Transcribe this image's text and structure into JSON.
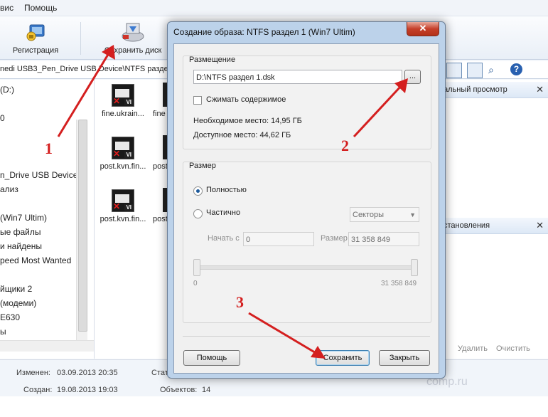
{
  "menu": {
    "items": [
      "вис",
      "Помощь"
    ]
  },
  "toolbar": {
    "register_label": "Регистрация",
    "save_disk_label": "Сохранить диск"
  },
  "address": {
    "path": "nedi USB3_Pen_Drive USB Device\\NTFS раздел 1"
  },
  "tree": {
    "items": [
      "(D:)",
      "0",
      "",
      "",
      "",
      "n_Drive USB Device",
      "ализ",
      "",
      " (Win7 Ultim)",
      "ые файлы",
      "и найдены",
      "peed Most Wanted",
      "",
      "йщики 2",
      "(модеми)",
      "E630",
      "ы"
    ]
  },
  "files": [
    {
      "name": "fine.ukrain..."
    },
    {
      "name": "post.kvn.fin..."
    },
    {
      "name": "post.kvn.fin..."
    }
  ],
  "files_clipped": [
    "fine",
    "post",
    "post"
  ],
  "right_pane": {
    "header1": "альный просмотр",
    "header2": "становления",
    "action_delete": "Удалить",
    "action_clear": "Очистить"
  },
  "status": {
    "modified_label": "Изменен:",
    "modified_value": "03.09.2013 20:35",
    "created_label": "Создан:",
    "created_value": "19.08.2013 19:03",
    "stat_clipped": "Стат",
    "objects_label": "Объектов:",
    "objects_value": "14",
    "watermark": "comp.ru"
  },
  "dialog": {
    "title": "Создание образа: NTFS раздел 1 (Win7 Ultim)",
    "close_glyph": "✕",
    "placement": {
      "legend": "Размещение",
      "path_value": "D:\\NTFS раздел 1.dsk",
      "browse_label": "...",
      "compress_label": "Сжимать содержимое",
      "compress_checked": false,
      "required_label": "Необходимое место: 14,95 ГБ",
      "available_label": "Доступное место: 44,62 ГБ"
    },
    "size": {
      "legend": "Размер",
      "full_label": "Полностью",
      "partial_label": "Частично",
      "selected": "full",
      "unit_select": "Секторы",
      "start_label": "Начать с",
      "start_value": "0",
      "size_label": "Размер",
      "size_value": "31 358 849",
      "slider_min": "0",
      "slider_max": "31 358 849"
    },
    "buttons": {
      "help": "Помощь",
      "save": "Сохранить",
      "close": "Закрыть"
    }
  },
  "annotations": {
    "one": "1",
    "two": "2",
    "three": "3"
  },
  "colors": {
    "arrow": "#d41f1f",
    "dialog_frame": "#bcd2ea",
    "close_button": "#c6402a"
  }
}
